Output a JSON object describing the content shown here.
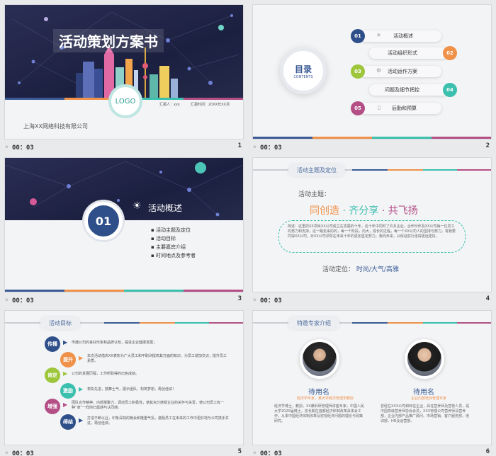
{
  "slides": [
    {
      "title": "活动策划方案书",
      "logo": "LOGO",
      "company": "上海XX网络科技有限公司",
      "reporter": "汇报人：xxx",
      "date": "汇报时间：20XX年XX月",
      "time": "00：03",
      "number": "1"
    },
    {
      "toc_title": "目录",
      "toc_sub": "CONTENTS",
      "items": [
        {
          "num": "01",
          "label": "活动概述",
          "color": "#2e4f8a"
        },
        {
          "num": "02",
          "label": "活动组织形式",
          "color": "#f0914a"
        },
        {
          "num": "03",
          "label": "活动运作方案",
          "color": "#9dc63b"
        },
        {
          "num": "04",
          "label": "问题及细节把控",
          "color": "#3bbfae"
        },
        {
          "num": "05",
          "label": "后勤和预算",
          "color": "#b44f86"
        }
      ],
      "time": "00：03",
      "number": "2"
    },
    {
      "num": "01",
      "section_title": "活动概述",
      "bullets": [
        "活动主题及定位",
        "活动目标",
        "主要嘉宾介绍",
        "时间地点及参考者"
      ],
      "time": "00：03",
      "number": "3"
    },
    {
      "header": "活动主题及定位",
      "theme_label": "活动主题：",
      "slogan_a": "同创造",
      "slogan_b": "· 齐分享",
      "slogan_c": "· 共飞扬",
      "desc": "简述：这里的XX项目XX公司成立在发展的十年，这十年中同时了许多企业。合作伙伴及XX公司每一位员工的努力和支持，这一路走来的的，每一个阶段，向大，成长的过程，每一个XX公司人的坚持与努力，将我要同得XX公司，对XX公司领导在未来十年的更加坚定努力，我向未来，以保证前行走得更远更好。",
      "position_label": "活动定位：",
      "position_value": "时尚/大气/高雅",
      "time": "00：03",
      "number": "4"
    },
    {
      "header": "活动目标",
      "rows": [
        {
          "tag": "传播",
          "text": "传播公司的良好形象和品牌认知，提进企业健康发展；",
          "color": "#2e4f8a"
        },
        {
          "tag": "提升",
          "text": "本次活动借庆XX表彰为广大员工和平职训提高其方面的知识、为员工增加交识，提升员工素质。",
          "color": "#f0914a"
        },
        {
          "tag": "肯定",
          "text": "公司的发展历程，工作所取得的出色成绩。",
          "color": "#9dc63b"
        },
        {
          "tag": "激励",
          "text": "表彰先进，鼓舞士气，展示团队、构筑梦想，再创佳绩！",
          "color": "#3bbfae"
        },
        {
          "tag": "增强",
          "text": "团队合作精神，内部凝聚力，调动员工积极性，使其充分感受企业的关怀与关爱，使公司员工有一种“家”一样的归属感与认同感。",
          "color": "#b44f86"
        },
        {
          "tag": "缔结",
          "text": "打造不断以业，印象深刻的晚会和隆重气氛，激励员工在未来的工作中更好地与公司携手并进，再创佳绩。",
          "color": "#2e4f8a"
        }
      ],
      "time": "00：03",
      "number": "5"
    },
    {
      "header": "特邀专家介绍",
      "experts": [
        {
          "name": "待用名",
          "role": "经济学专家，某大学经济管理学教授",
          "bio": "经济学博士，教授，XX教科研管理师讲座专家，中国人民大学2020届博士，曾长期在首都经济体制改革具体会工作，从事中国经济体制改革及宏观经济问题的理论与政策研究。"
        },
        {
          "name": "待用名",
          "role": "企业内部培训管理专家",
          "bio": "曾经在XXX公司和知名企业，具任营养师及营管人员，是中国高级营养师协会会员，XXX管理公司营养师及营养部，企业内部产品推广顾问、市场营销、客户服务部，培训部、HR及运营部。"
        }
      ],
      "time": "00：03",
      "number": "6"
    }
  ],
  "stripe_colors": [
    "#3a5b95",
    "#f0914a",
    "#3bbfae",
    "#b44f86"
  ]
}
